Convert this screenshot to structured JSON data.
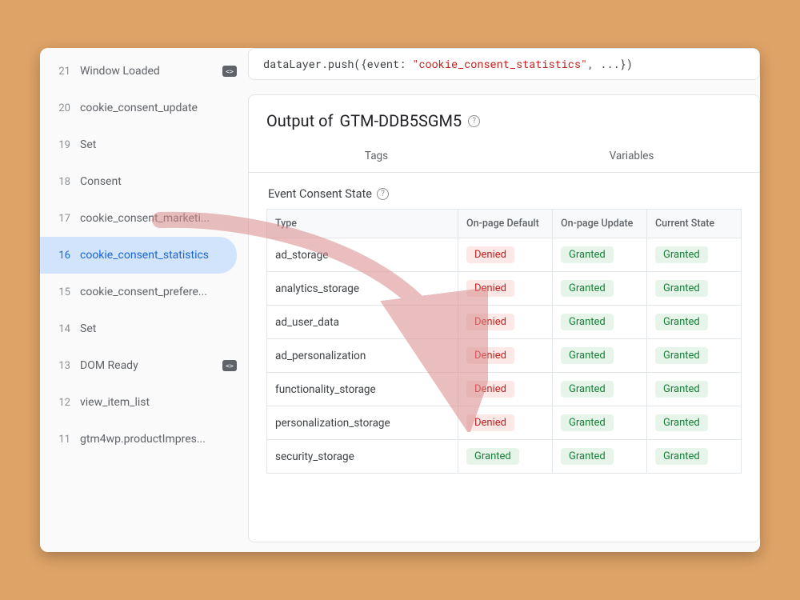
{
  "sidebar": {
    "items": [
      {
        "num": "21",
        "label": "Window Loaded",
        "icon": true,
        "selected": false
      },
      {
        "num": "20",
        "label": "cookie_consent_update",
        "icon": false,
        "selected": false
      },
      {
        "num": "19",
        "label": "Set",
        "icon": false,
        "selected": false
      },
      {
        "num": "18",
        "label": "Consent",
        "icon": false,
        "selected": false
      },
      {
        "num": "17",
        "label": "cookie_consent_marketi...",
        "icon": false,
        "selected": false
      },
      {
        "num": "16",
        "label": "cookie_consent_statistics",
        "icon": false,
        "selected": true
      },
      {
        "num": "15",
        "label": "cookie_consent_prefere...",
        "icon": false,
        "selected": false
      },
      {
        "num": "14",
        "label": "Set",
        "icon": false,
        "selected": false
      },
      {
        "num": "13",
        "label": "DOM Ready",
        "icon": true,
        "selected": false
      },
      {
        "num": "12",
        "label": "view_item_list",
        "icon": false,
        "selected": false
      },
      {
        "num": "11",
        "label": "gtm4wp.productImpres...",
        "icon": false,
        "selected": false
      }
    ]
  },
  "code": {
    "prefix": "dataLayer.push({event: ",
    "string": "\"cookie_consent_statistics\"",
    "suffix": ", ...})"
  },
  "panel": {
    "title_prefix": "Output of ",
    "container_id": "GTM-DDB5SGM5",
    "tabs": [
      {
        "label": "Tags"
      },
      {
        "label": "Variables"
      }
    ],
    "section_title": "Event Consent State"
  },
  "table": {
    "headers": [
      "Type",
      "On-page Default",
      "On-page Update",
      "Current State"
    ],
    "rows": [
      {
        "type": "ad_storage",
        "default": "Denied",
        "update": "Granted",
        "state": "Granted"
      },
      {
        "type": "analytics_storage",
        "default": "Denied",
        "update": "Granted",
        "state": "Granted"
      },
      {
        "type": "ad_user_data",
        "default": "Denied",
        "update": "Granted",
        "state": "Granted"
      },
      {
        "type": "ad_personalization",
        "default": "Denied",
        "update": "Granted",
        "state": "Granted"
      },
      {
        "type": "functionality_storage",
        "default": "Denied",
        "update": "Granted",
        "state": "Granted"
      },
      {
        "type": "personalization_storage",
        "default": "Denied",
        "update": "Granted",
        "state": "Granted"
      },
      {
        "type": "security_storage",
        "default": "Granted",
        "update": "Granted",
        "state": "Granted"
      }
    ]
  },
  "badges": {
    "Denied": "denied",
    "Granted": "granted"
  }
}
